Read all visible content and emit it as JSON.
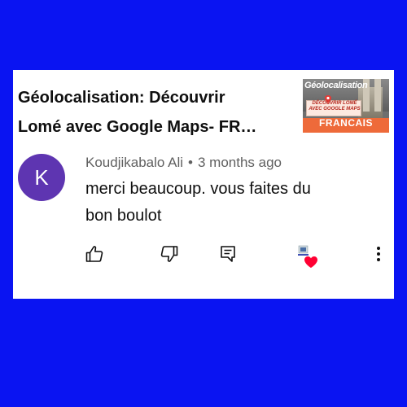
{
  "video": {
    "title_line1": "Géolocalisation: Découvrir",
    "title_line2": "Lomé avec Google Maps- FR…",
    "thumbnail": {
      "title": "Géolocalisation",
      "subtitle": "DÉCOUVRIR LOMÉ AVEC GOOGLE MAPS",
      "language": "FRANCAIS"
    }
  },
  "comment": {
    "avatar_letter": "K",
    "avatar_color": "#5e35b1",
    "author": "Koudjikabalo Ali",
    "separator": "•",
    "time": "3 months ago",
    "text_line1": "merci beaucoup. vous faites du",
    "text_line2": "bon boulot"
  },
  "actions": {
    "like_icon": "thumb-up-icon",
    "dislike_icon": "thumb-down-icon",
    "reply_icon": "comment-icon",
    "creator_heart_icon": "creator-heart-icon",
    "more_icon": "more-vertical-icon",
    "heart_color": "#ff0033"
  },
  "colors": {
    "background": "#0a14f2",
    "card": "#ffffff"
  }
}
